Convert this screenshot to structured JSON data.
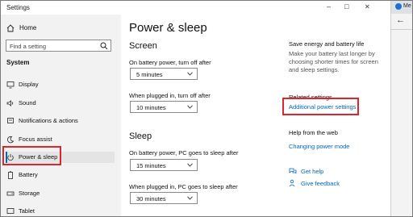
{
  "window": {
    "title": "Settings",
    "minimize": "–",
    "maximize": "□",
    "close": "✕"
  },
  "sidebar": {
    "home_label": "Home",
    "search_placeholder": "Find a setting",
    "section_label": "System",
    "items": [
      {
        "label": "Display",
        "icon": "display-icon"
      },
      {
        "label": "Sound",
        "icon": "sound-icon"
      },
      {
        "label": "Notifications & actions",
        "icon": "notifications-icon"
      },
      {
        "label": "Focus assist",
        "icon": "focus-assist-icon"
      },
      {
        "label": "Power & sleep",
        "icon": "power-icon",
        "active": true
      },
      {
        "label": "Battery",
        "icon": "battery-icon"
      },
      {
        "label": "Storage",
        "icon": "storage-icon"
      },
      {
        "label": "Tablet",
        "icon": "tablet-icon"
      }
    ]
  },
  "main": {
    "title": "Power & sleep",
    "screen": {
      "heading": "Screen",
      "battery_label": "On battery power, turn off after",
      "battery_value": "5 minutes",
      "plugged_label": "When plugged in, turn off after",
      "plugged_value": "10 minutes"
    },
    "sleep": {
      "heading": "Sleep",
      "battery_label": "On battery power, PC goes to sleep after",
      "battery_value": "15 minutes",
      "plugged_label": "When plugged in, PC goes to sleep after",
      "plugged_value": "30 minutes"
    }
  },
  "right_column": {
    "save_heading": "Save energy and battery life",
    "save_text": "Make your battery last longer by choosing shorter times for screen and sleep settings.",
    "related_heading": "Related settings",
    "additional_power_link": "Additional power settings",
    "help_heading": "Help from the web",
    "changing_power_link": "Changing power mode",
    "get_help": "Get help",
    "give_feedback": "Give feedback"
  },
  "adjacent_window": {
    "title_fragment": "Me",
    "back_glyph": "←"
  },
  "colors": {
    "accent": "#0067c0",
    "highlight": "#e0232d",
    "sidebar_bg": "#f2f2f2"
  }
}
